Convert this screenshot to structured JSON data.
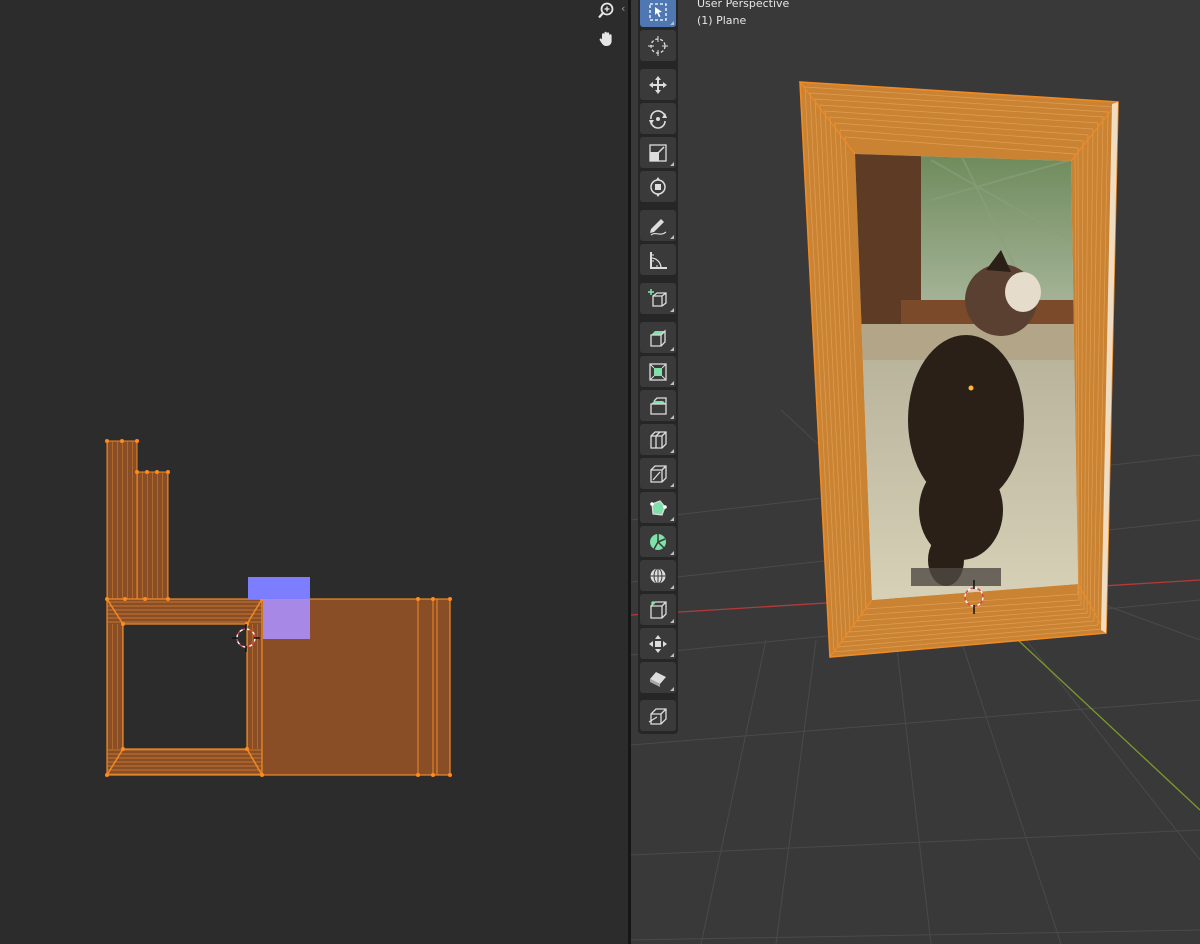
{
  "viewport": {
    "perspective_label": "User Perspective",
    "object_label": "(1) Plane"
  },
  "uv_editor": {
    "nav_icons": [
      "zoom-icon",
      "hand-pan-icon"
    ]
  },
  "toolbar": {
    "tools": [
      {
        "name": "select-box",
        "active": true
      },
      {
        "name": "cursor"
      },
      {
        "name": "move"
      },
      {
        "name": "rotate"
      },
      {
        "name": "scale"
      },
      {
        "name": "transform"
      },
      {
        "name": "annotate"
      },
      {
        "name": "measure"
      },
      {
        "name": "add-cube"
      },
      {
        "name": "extrude-region"
      },
      {
        "name": "inset-faces"
      },
      {
        "name": "bevel"
      },
      {
        "name": "loop-cut"
      },
      {
        "name": "knife"
      },
      {
        "name": "poly-build"
      },
      {
        "name": "spin"
      },
      {
        "name": "smooth"
      },
      {
        "name": "edge-slide"
      },
      {
        "name": "shrink-fatten"
      },
      {
        "name": "shear"
      },
      {
        "name": "rip-region"
      }
    ]
  },
  "colors": {
    "selection": "#f08a24",
    "frame_fill": "#c98333",
    "uv_fill": "#8a4e26",
    "active_tool": "#4f78b3",
    "x_axis": "#b33a3a",
    "y_axis": "#7c9a2e",
    "uv_preview_top": "#7d7dff",
    "uv_preview_face": "#a98bf0"
  }
}
